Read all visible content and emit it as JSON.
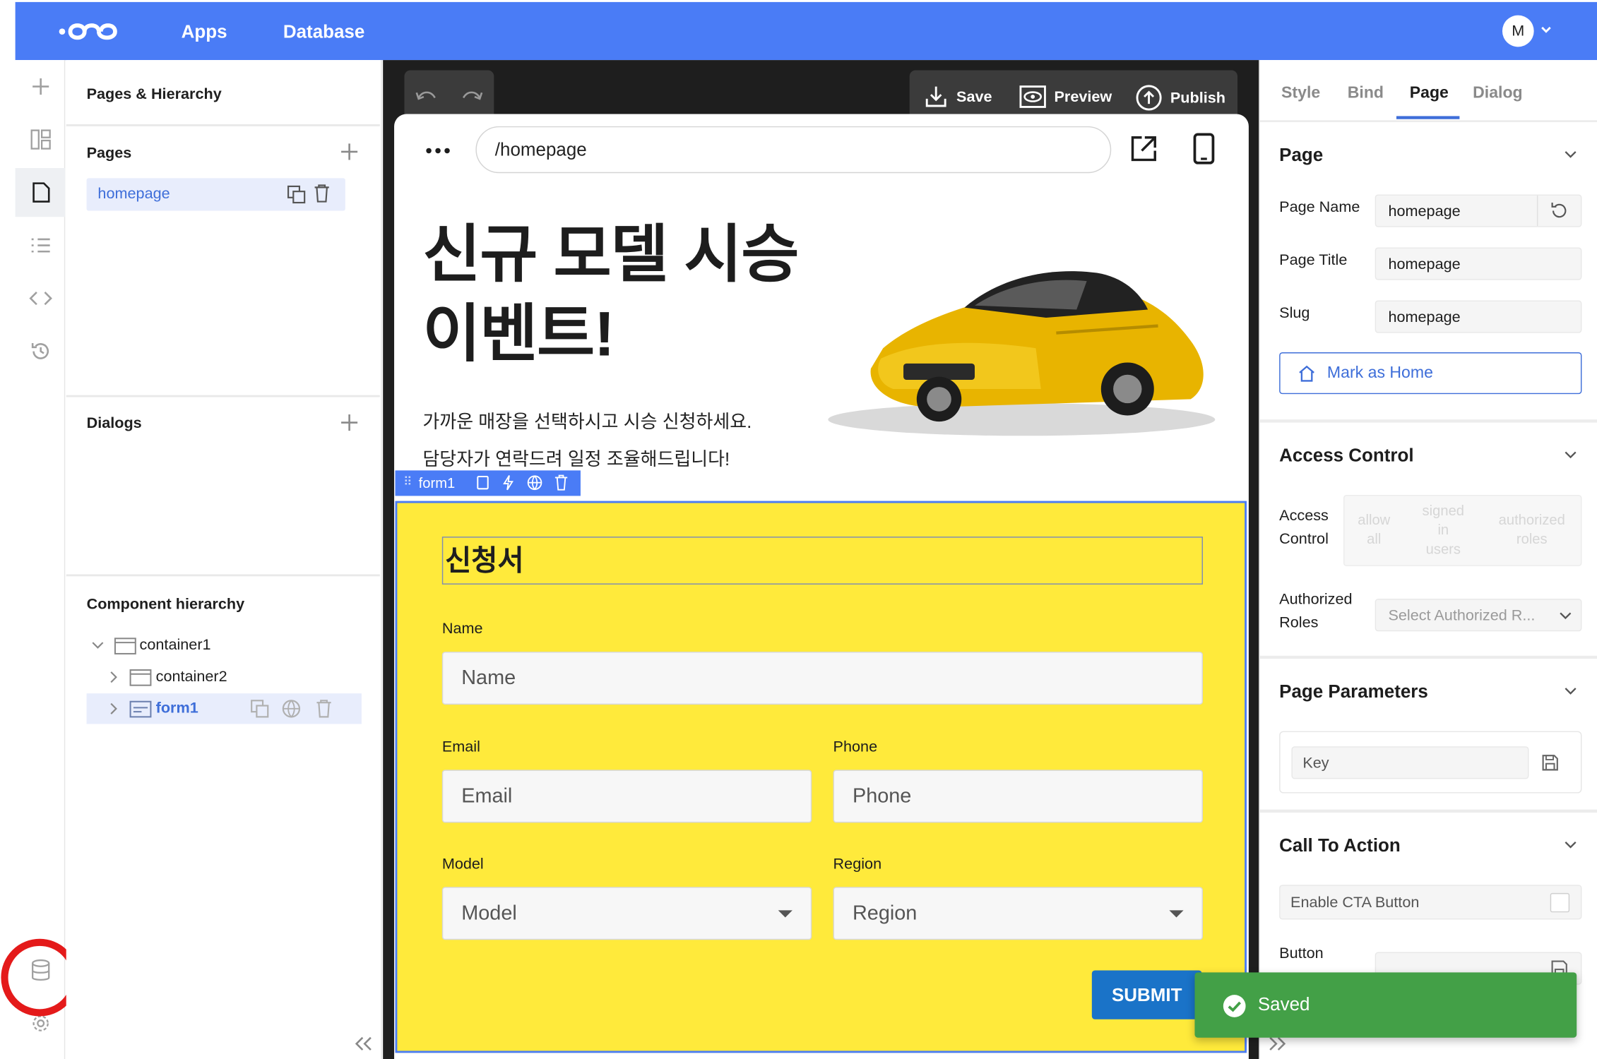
{
  "topbar": {
    "nav_apps": "Apps",
    "nav_database": "Database",
    "avatar_initial": "M",
    "color": "#4a7cf6"
  },
  "rail": {
    "icons": [
      "plus-icon",
      "layout-icon",
      "page-icon",
      "list-icon",
      "code-icon",
      "history-icon",
      "database-icon",
      "settings-icon"
    ]
  },
  "pages_panel": {
    "title": "Pages & Hierarchy",
    "pages_heading": "Pages",
    "pages": [
      "homepage"
    ],
    "dialogs_heading": "Dialogs",
    "hierarchy_heading": "Component hierarchy",
    "tree": [
      {
        "label": "container1",
        "expanded": true
      },
      {
        "label": "container2",
        "expanded": false
      },
      {
        "label": "form1",
        "expanded": false,
        "selected": true
      }
    ]
  },
  "toolbar": {
    "save": "Save",
    "preview": "Preview",
    "publish": "Publish"
  },
  "preview": {
    "url": "/homepage",
    "hero_title_line1": "신규 모델 시승",
    "hero_title_line2": "이벤트!",
    "hero_sub_line1": "가까운 매장을 선택하시고 시승 신청하세요.",
    "hero_sub_line2": "담당자가 연락드려 일정 조율해드립니다!",
    "form_tag": "form1",
    "form": {
      "background": "#ffea3b",
      "heading": "신청서",
      "name_label": "Name",
      "name_placeholder": "Name",
      "email_label": "Email",
      "email_placeholder": "Email",
      "phone_label": "Phone",
      "phone_placeholder": "Phone",
      "model_label": "Model",
      "model_placeholder": "Model",
      "region_label": "Region",
      "region_placeholder": "Region",
      "submit": "SUBMIT"
    }
  },
  "inspector": {
    "tabs": [
      "Style",
      "Bind",
      "Page",
      "Dialog"
    ],
    "active_tab": "Page",
    "page_section": "Page",
    "page_name_label": "Page Name",
    "page_name_value": "homepage",
    "page_title_label": "Page Title",
    "page_title_value": "homepage",
    "slug_label": "Slug",
    "slug_value": "homepage",
    "mark_home": "Mark as Home",
    "access_section": "Access Control",
    "access_label_1": "Access",
    "access_label_2": "Control",
    "access_opt_1a": "allow",
    "access_opt_1b": "all",
    "access_opt_2a": "signed",
    "access_opt_2b": "in",
    "access_opt_2c": "users",
    "access_opt_3a": "authorized",
    "access_opt_3b": "roles",
    "roles_label_1": "Authorized",
    "roles_label_2": "Roles",
    "roles_placeholder": "Select Authorized R...",
    "params_section": "Page Parameters",
    "key_placeholder": "Key",
    "cta_section": "Call To Action",
    "cta_enable": "Enable CTA Button",
    "button_label": "Button"
  },
  "toast": {
    "message": "Saved",
    "color": "#43a047"
  }
}
